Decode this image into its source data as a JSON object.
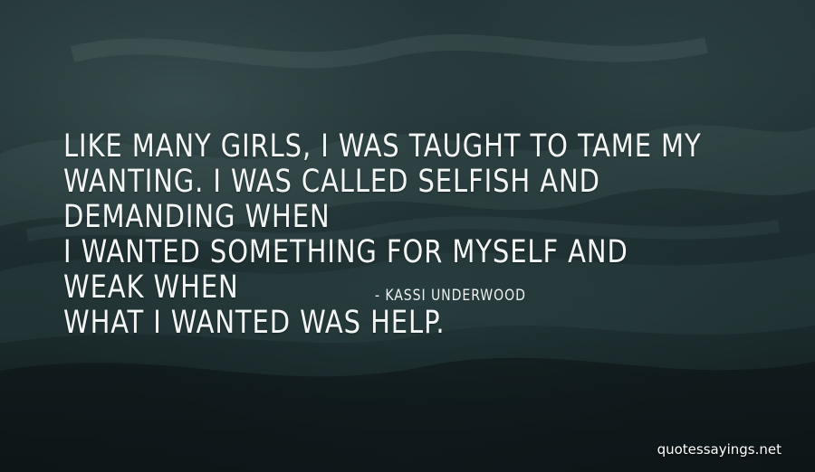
{
  "quote": {
    "lines": [
      "LIKE MANY GIRLS, I WAS TAUGHT TO TAME MY",
      "WANTING. I WAS CALLED SELFISH AND DEMANDING WHEN",
      "I WANTED SOMETHING FOR MYSELF AND WEAK WHEN",
      "WHAT I WANTED WAS HELP."
    ],
    "author": "- KASSI UNDERWOOD"
  },
  "watermark": "quotessayings.net",
  "colors": {
    "text": "#f4f6f5",
    "background_dark": "#111b1c",
    "background_mid": "#243537"
  }
}
